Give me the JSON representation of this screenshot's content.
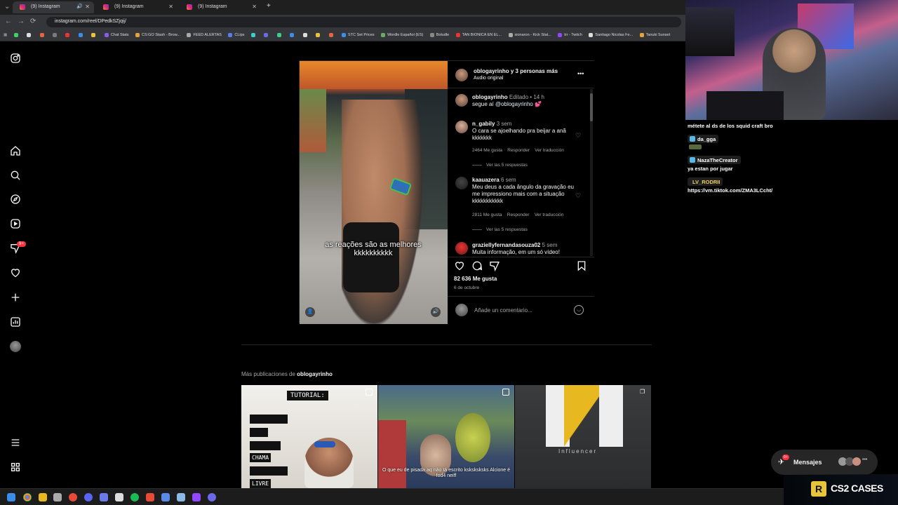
{
  "browser": {
    "tabs": [
      {
        "title": "(9) Instagram",
        "active": true
      },
      {
        "title": "(9) Instagram",
        "active": false
      },
      {
        "title": "(9) Instagram",
        "active": false
      }
    ],
    "new_tab": "+",
    "url": "instagram.com/reel/DPedkSZjqij/",
    "bookmarks": [
      "Chat Stats",
      "CS:GO Stash - Brow...",
      "FEED ALERTAS",
      "CLips",
      "STC Set Prices",
      "Wordle Español (ES)",
      "Boludle",
      "TAN BIONICA EN EL...",
      "sionaron - Kick Stat...",
      "trr - Twitch",
      "Santiago Nicolas Fe...",
      "Tanuki Sunset"
    ]
  },
  "sidebar": {
    "icons": [
      "instagram-logo-icon",
      "home-icon",
      "search-icon",
      "explore-icon",
      "reels-icon",
      "messages-icon",
      "notifications-heart-icon",
      "create-icon",
      "dashboard-icon",
      "profile-avatar",
      "menu-icon",
      "more-icon"
    ],
    "notification_badge": "9+"
  },
  "reel": {
    "caption": "as reações são as melhores kkkkkkkkkk",
    "header_user": "oblogayrinho y 3 personas más",
    "header_audio": "Audio original",
    "more": "•••",
    "owner_comment": {
      "user": "oblogayrinho",
      "edited": "Editado",
      "time": "14 h",
      "text": "segue aí",
      "mention": "@oblogayrinho",
      "emoji": "💕"
    },
    "comments": [
      {
        "user": "n_gabily",
        "time": "3 sem",
        "text": "O cara se ajoelhando pra beijar a anã kkkkkkk",
        "likes": "2464 Me gusta",
        "reply": "Responder",
        "translate": "Ver traducción",
        "view_replies": "Ver las 5 respuestas"
      },
      {
        "user": "kaauazera",
        "time": "6 sem",
        "text": "Meu deus a cada ângulo da gravação eu me impressiono mais com a situação kkkkkkkkkkk",
        "likes": "2811 Me gusta",
        "reply": "Responder",
        "translate": "Ver traducción",
        "view_replies": "Ver las 5 respuestas"
      },
      {
        "user": "graziellyfernandasouza02",
        "time": "5 sem",
        "text": "Muita informação, em um só vídeo!"
      }
    ],
    "likes_count": "82 636 Me gusta",
    "date": "6 de octubre",
    "comment_placeholder": "Añade un comentario..."
  },
  "more_posts": {
    "prefix": "Más publicaciones de",
    "user": "oblogayrinho",
    "thumbs": [
      {
        "overlay_title": "TUTORIAL:",
        "words": [
          "CHAMA",
          "LIVRE"
        ]
      },
      {
        "caption": "O que eu de pisada aq não tá escrito ksksksksks Alcione é fod4 neiff"
      },
      {
        "text": "Influencer"
      }
    ]
  },
  "stream": {
    "chat": [
      {
        "type": "text",
        "text": "métete al ds de los squid craft bro"
      },
      {
        "type": "badge",
        "user": "da_gga"
      },
      {
        "type": "badge",
        "user": "NazaTheCreator"
      },
      {
        "type": "text",
        "text": "ya estan por jugar"
      },
      {
        "type": "badge",
        "user": "LV_RODRII"
      },
      {
        "type": "text",
        "text": "https://vm.tiktok.com/ZMA3LCcht/"
      }
    ],
    "messages_label": "Mensajes",
    "messages_badge": "9+",
    "messages_more": "•••",
    "promo": "CS2 CASES",
    "promo_logo": "R"
  },
  "colors": {
    "mention": "#e0f1ff",
    "badge_red": "#ff3040",
    "chrome_bg": "#35363a"
  }
}
